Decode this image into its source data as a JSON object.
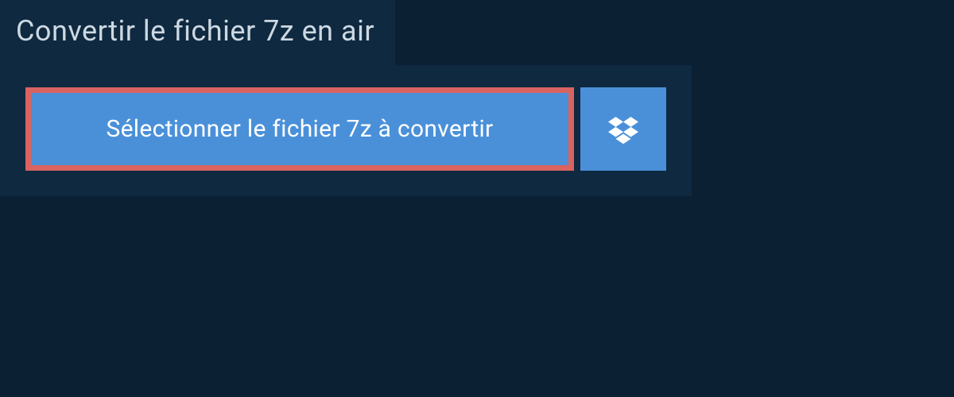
{
  "heading": "Convertir le fichier 7z en air",
  "buttons": {
    "select_label": "Sélectionner le fichier 7z à convertir"
  }
}
